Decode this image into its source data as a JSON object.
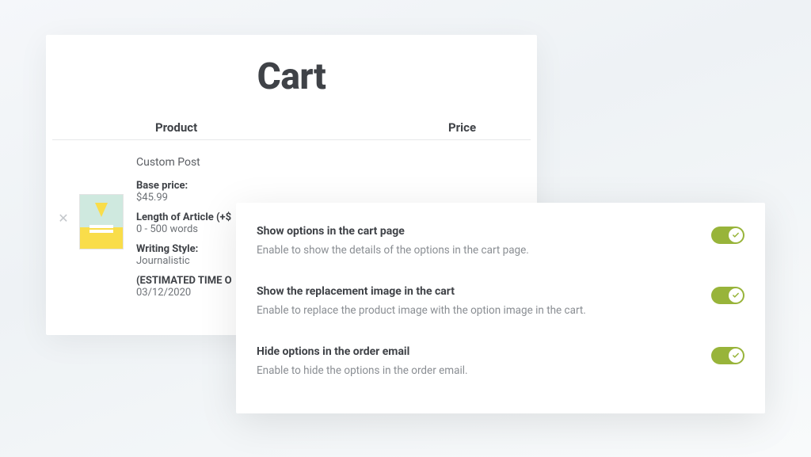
{
  "cart": {
    "title": "Cart",
    "columns": {
      "product": "Product",
      "price": "Price"
    },
    "item": {
      "name": "Custom Post",
      "base_price_label": "Base price:",
      "base_price_value": "$45.99",
      "length_label": "Length of Article (+$",
      "length_value": "0 - 500 words",
      "style_label": "Writing Style:",
      "style_value": "Journalistic",
      "estimate_label": "(ESTIMATED TIME O",
      "estimate_value": "03/12/2020"
    }
  },
  "settings": [
    {
      "title": "Show options in the cart page",
      "desc": "Enable to show the details of the options in the cart page.",
      "on": true
    },
    {
      "title": "Show the replacement image in the cart",
      "desc": "Enable to replace the product image with the option image in the cart.",
      "on": true
    },
    {
      "title": "Hide options in the order email",
      "desc": "Enable to hide the options in the order email.",
      "on": true
    }
  ],
  "colors": {
    "accent": "#98b43a"
  }
}
